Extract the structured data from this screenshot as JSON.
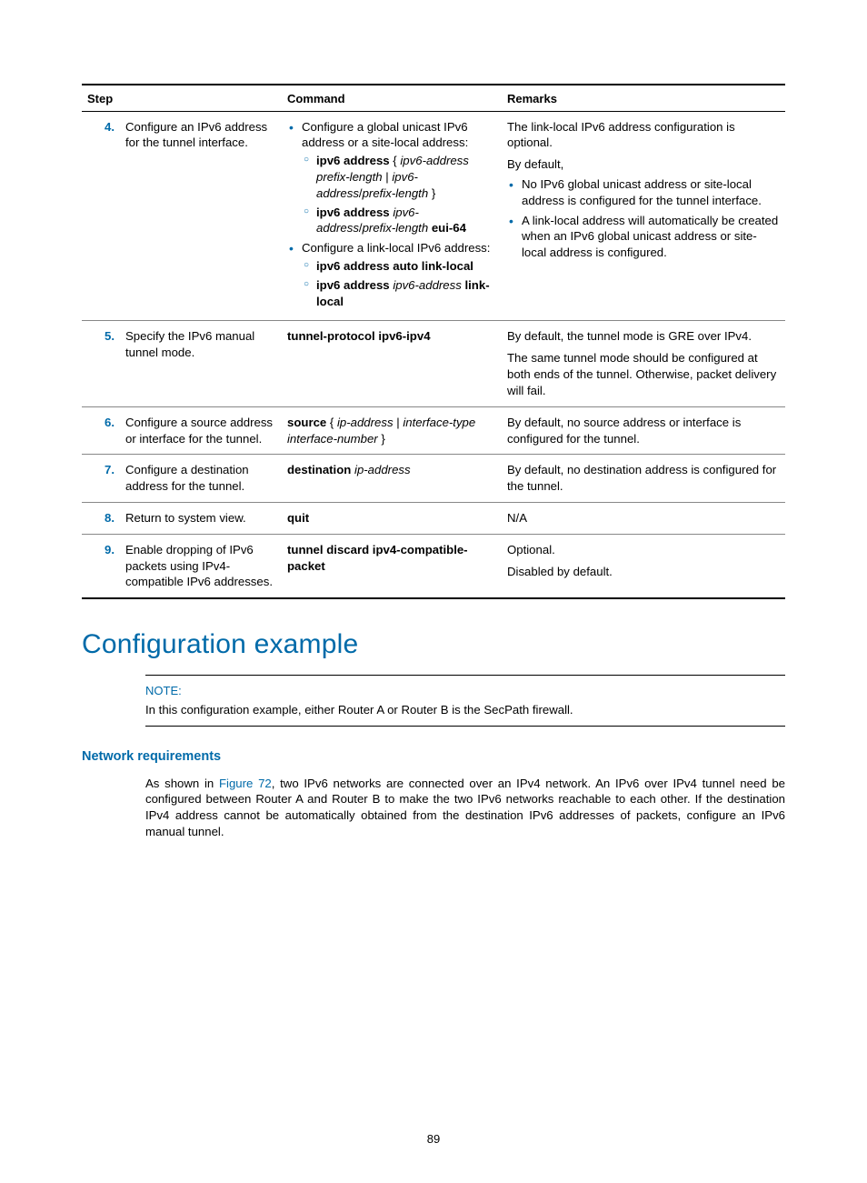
{
  "table": {
    "headers": {
      "step": "Step",
      "command": "Command",
      "remarks": "Remarks"
    },
    "rows": [
      {
        "num": "4.",
        "desc": "Configure an IPv6 address for the tunnel interface.",
        "cmd_html": "<ul class=\"b1\"><li>Configure a global unicast IPv6 address or a site-local address:<ul class=\"b2\"><li><b>ipv6 address</b> { <i>ipv6-address prefix-length</i> | <i>ipv6-address</i>/<i>prefix-length</i> }</li><li><b>ipv6 address</b> <i>ipv6-address</i>/<i>prefix-length</i> <b>eui-64</b></li></ul></li><li>Configure a link-local IPv6 address:<ul class=\"b2\"><li><b>ipv6 address auto link-local</b></li><li><b>ipv6 address</b> <i>ipv6-address</i> <b>link-local</b></li></ul></li></ul>",
        "rem_html": "The link-local IPv6 address configuration is optional.<div style=\"height:6px\"></div>By default,<ul class=\"b1\" style=\"margin-top:4px\"><li>No IPv6 global unicast address or site-local address is configured for the tunnel interface.</li><li>A link-local address will automatically be created when an IPv6 global unicast address or site-local address is configured.</li></ul>"
      },
      {
        "num": "5.",
        "desc": "Specify the IPv6 manual tunnel mode.",
        "cmd_html": "<b>tunnel-protocol ipv6-ipv4</b>",
        "rem_html": "By default, the tunnel mode is GRE over IPv4.<div style=\"height:6px\"></div>The same tunnel mode should be configured at both ends of the tunnel. Otherwise, packet delivery will fail."
      },
      {
        "num": "6.",
        "desc": "Configure a source address or interface for the tunnel.",
        "cmd_html": "<b>source</b> { <i>ip-address</i> | <i>interface-type interface-number</i> }",
        "rem_html": "By default, no source address or interface is configured for the tunnel."
      },
      {
        "num": "7.",
        "desc": "Configure a destination address for the tunnel.",
        "cmd_html": "<b>destination</b> <i>ip-address</i>",
        "rem_html": "By default, no destination address is configured for the tunnel."
      },
      {
        "num": "8.",
        "desc": "Return to system view.",
        "cmd_html": "<b>quit</b>",
        "rem_html": "N/A"
      },
      {
        "num": "9.",
        "desc": "Enable dropping of IPv6 packets using IPv4-compatible IPv6 addresses.",
        "cmd_html": "<b>tunnel discard ipv4-compatible-packet</b>",
        "rem_html": "Optional.<div style=\"height:6px\"></div>Disabled by default."
      }
    ]
  },
  "section_title": "Configuration example",
  "note": {
    "label": "NOTE:",
    "text": "In this configuration example, either Router A or Router B is the SecPath firewall."
  },
  "subhead": "Network requirements",
  "paragraph_pre": "As shown in ",
  "figure_ref": "Figure 72",
  "paragraph_post": ", two IPv6 networks are connected over an IPv4 network. An IPv6 over IPv4 tunnel need be configured between Router A and Router B to make the two IPv6 networks reachable to each other. If the destination IPv4 address cannot be automatically obtained from the destination IPv6 addresses of packets, configure an IPv6 manual tunnel.",
  "page_number": "89"
}
